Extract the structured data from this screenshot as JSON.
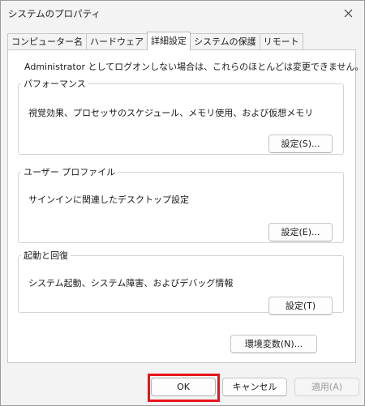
{
  "window": {
    "title": "システムのプロパティ"
  },
  "tabs": [
    {
      "label": "コンピューター名"
    },
    {
      "label": "ハードウェア"
    },
    {
      "label": "詳細設定"
    },
    {
      "label": "システムの保護"
    },
    {
      "label": "リモート"
    }
  ],
  "active_tab": "詳細設定",
  "panel": {
    "notice": "Administrator としてログオンしない場合は、これらのほとんどは変更できません。",
    "performance": {
      "legend": "パフォーマンス",
      "description": "視覚効果、プロセッサのスケジュール、メモリ使用、および仮想メモリ",
      "button_label": "設定(S)..."
    },
    "user_profile": {
      "legend": "ユーザー プロファイル",
      "description": "サインインに関連したデスクトップ設定",
      "button_label": "設定(E)..."
    },
    "startup_recovery": {
      "legend": "起動と回復",
      "description": "システム起動、システム障害、およびデバッグ情報",
      "button_label": "設定(T)"
    },
    "env_button_label": "環境変数(N)..."
  },
  "footer": {
    "ok_label": "OK",
    "cancel_label": "キャンセル",
    "apply_label": "適用(A)"
  },
  "colors": {
    "highlight": "#e8141b",
    "window_bg": "#f3f3f3",
    "panel_bg": "#ffffff"
  },
  "icons": {
    "close": "close-icon"
  }
}
